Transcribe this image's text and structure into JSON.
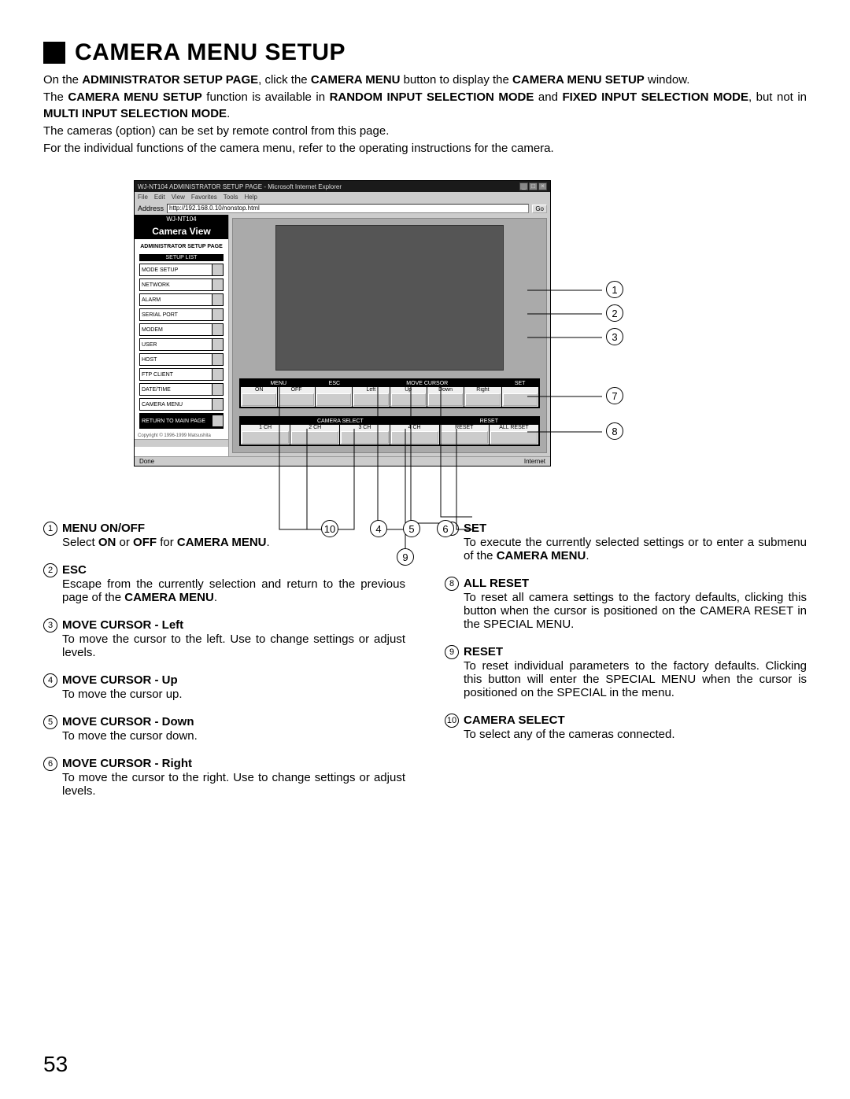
{
  "title": "CAMERA MENU SETUP",
  "intro_lines": [
    "On the <b>ADMINISTRATOR SETUP PAGE</b>, click the <b>CAMERA MENU</b> button to display the <b>CAMERA MENU SETUP</b> window.",
    "The <b>CAMERA MENU SETUP</b> function is available in <b>RANDOM INPUT SELECTION MODE</b> and <b>FIXED INPUT SELECTION MODE</b>, but not in <b>MULTI INPUT SELECTION MODE</b>.",
    "The cameras (option) can be set by remote control from this page.",
    "For the individual functions of the camera menu, refer to the operating instructions for the camera."
  ],
  "browser": {
    "title": "WJ-NT104 ADMINISTRATOR SETUP PAGE - Microsoft Internet Explorer",
    "menus": [
      "File",
      "Edit",
      "View",
      "Favorites",
      "Tools",
      "Help"
    ],
    "address_label": "Address",
    "address_value": "http://192.168.0.10/nonstop.html",
    "go_label": "Go",
    "status_left": "Done",
    "status_right": "Internet"
  },
  "sidebar": {
    "logo": "WJ-NT104",
    "title": "Camera View",
    "subtitle": "ADMINISTRATOR SETUP PAGE",
    "setup_header": "SETUP LIST",
    "items": [
      "MODE SETUP",
      "NETWORK",
      "ALARM",
      "SERIAL PORT",
      "MODEM",
      "USER",
      "HOST",
      "FTP CLIENT",
      "DATE/TIME",
      "CAMERA MENU"
    ],
    "return_label": "RETURN TO MAIN PAGE",
    "copyright": "Copyright © 1996-1999 Matsushita"
  },
  "panel1": {
    "groups": [
      {
        "header": "MENU",
        "labels": [
          "ON",
          "OFF"
        ]
      },
      {
        "header": "ESC",
        "labels": [
          ""
        ]
      },
      {
        "header": "MOVE CURSOR",
        "labels": [
          "Left",
          "Up",
          "Down",
          "Right"
        ]
      },
      {
        "header": "SET",
        "labels": [
          ""
        ]
      }
    ]
  },
  "panel2": {
    "groups": [
      {
        "header": "CAMERA SELECT",
        "labels": [
          "1 CH",
          "2 CH",
          "3 CH",
          "4 CH"
        ]
      },
      {
        "header": "RESET",
        "labels": [
          "RESET",
          "ALL RESET"
        ]
      }
    ]
  },
  "callouts": {
    "1": "①",
    "2": "②",
    "3": "③",
    "4": "④",
    "5": "⑤",
    "6": "⑥",
    "7": "⑦",
    "8": "⑧",
    "9": "⑨",
    "10": "⑩"
  },
  "desc_left": [
    {
      "n": "1",
      "title": "MENU ON/OFF",
      "body": "Select <b>ON</b> or <b>OFF</b> for <b>CAMERA MENU</b>."
    },
    {
      "n": "2",
      "title": "ESC",
      "body": "Escape from the currently selection and return to the previous page of the <b>CAMERA MENU</b>."
    },
    {
      "n": "3",
      "title": "MOVE CURSOR - Left",
      "body": "To move the cursor to the left. Use to change settings or adjust levels."
    },
    {
      "n": "4",
      "title": "MOVE CURSOR - Up",
      "body": "To move the cursor up."
    },
    {
      "n": "5",
      "title": "MOVE CURSOR - Down",
      "body": "To move the cursor down."
    },
    {
      "n": "6",
      "title": "MOVE CURSOR - Right",
      "body": "To move the cursor to the right. Use to change settings or adjust levels."
    }
  ],
  "desc_right": [
    {
      "n": "7",
      "title": "SET",
      "body": "To execute the currently selected settings or to enter a submenu of the <b>CAMERA MENU</b>."
    },
    {
      "n": "8",
      "title": "ALL RESET",
      "body": "To reset all camera settings to the factory defaults, clicking this button when the cursor is positioned on the CAMERA RESET in the SPECIAL MENU."
    },
    {
      "n": "9",
      "title": "RESET",
      "body": "To reset individual parameters to the factory defaults. Clicking this button will enter the SPECIAL MENU when the cursor is positioned on the SPECIAL in the menu."
    },
    {
      "n": "10",
      "title": "CAMERA SELECT",
      "body": "To select any of the cameras connected."
    }
  ],
  "page_number": "53"
}
